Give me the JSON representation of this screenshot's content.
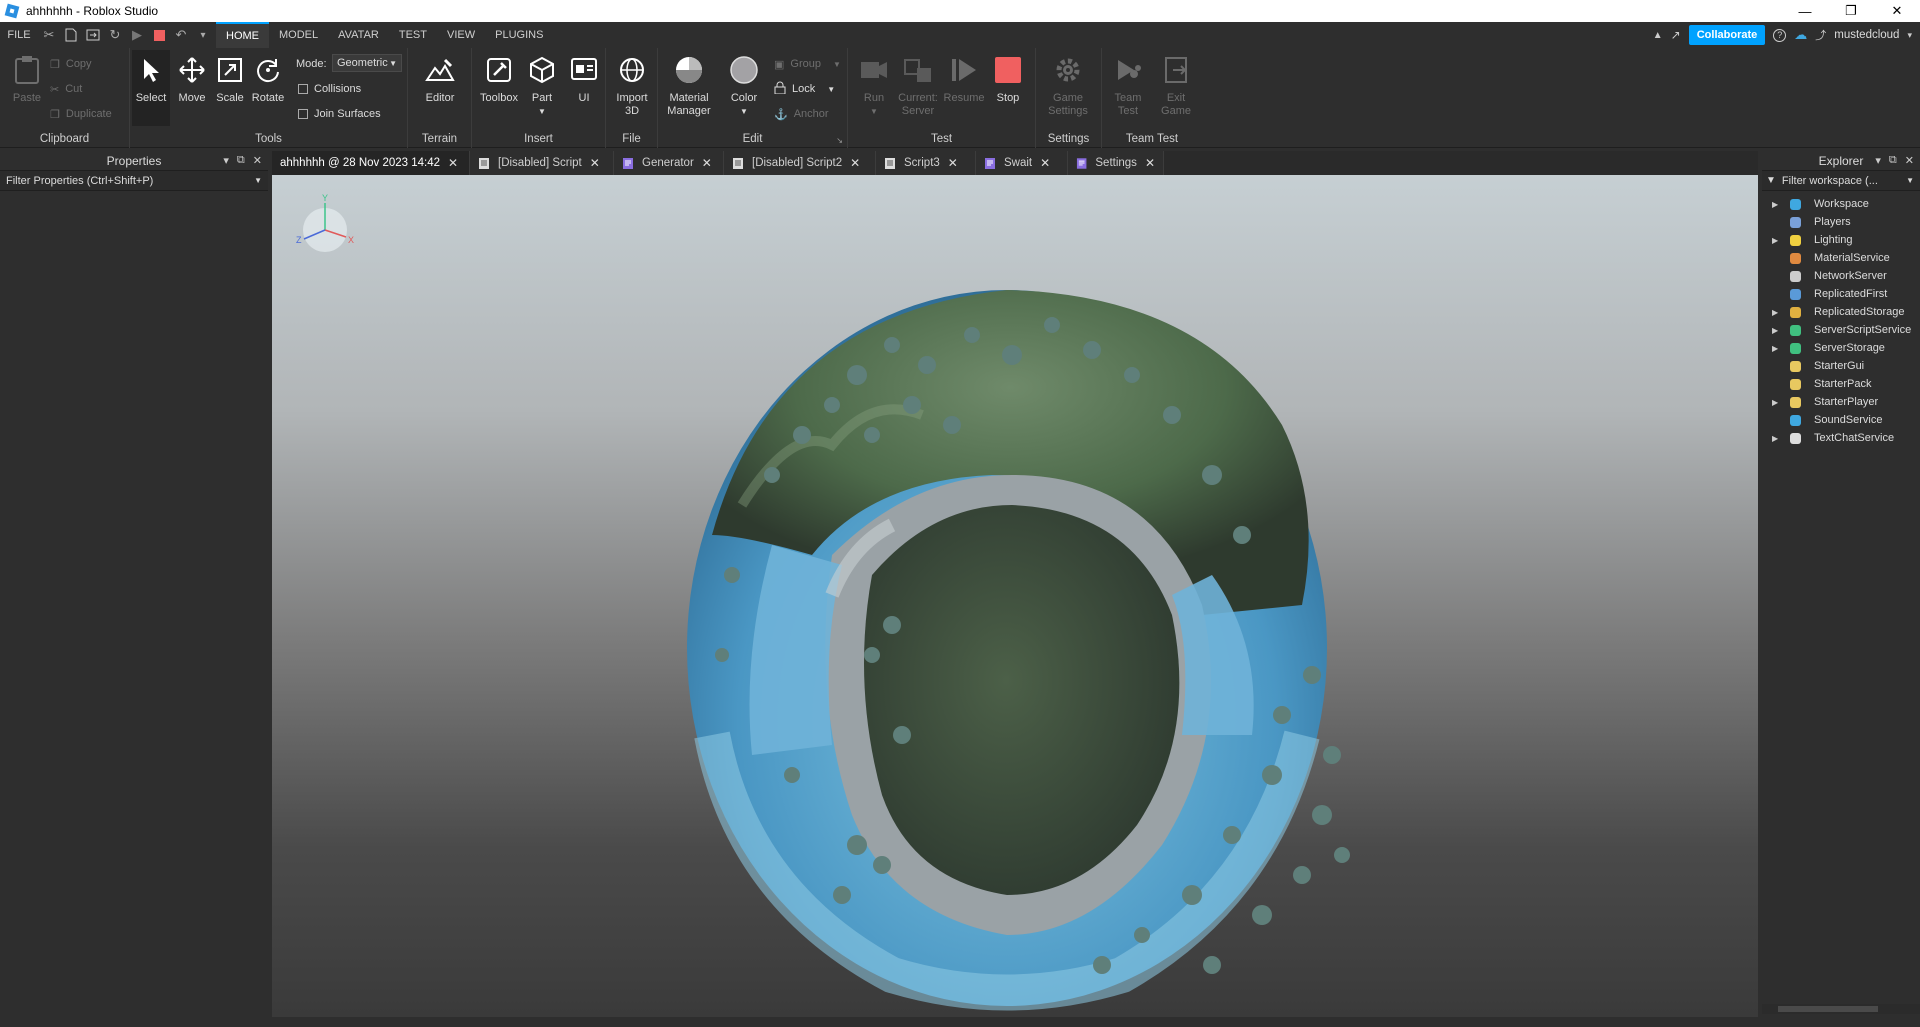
{
  "window": {
    "title": "ahhhhhh - Roblox Studio"
  },
  "menu": {
    "tabs": [
      "FILE",
      "HOME",
      "MODEL",
      "AVATAR",
      "TEST",
      "VIEW",
      "PLUGINS"
    ],
    "active": "HOME",
    "collaborate": "Collaborate",
    "user": "mustedcloud"
  },
  "ribbon": {
    "clipboard": {
      "label": "Clipboard",
      "paste": "Paste",
      "copy": "Copy",
      "cut": "Cut",
      "duplicate": "Duplicate"
    },
    "tools": {
      "label": "Tools",
      "select": "Select",
      "move": "Move",
      "scale": "Scale",
      "rotate": "Rotate",
      "mode_label": "Mode:",
      "mode_value": "Geometric",
      "collisions": "Collisions",
      "join_surfaces": "Join Surfaces"
    },
    "terrain": {
      "label": "Terrain",
      "editor": "Editor"
    },
    "insert": {
      "label": "Insert",
      "toolbox": "Toolbox",
      "part": "Part",
      "ui": "UI"
    },
    "file": {
      "label": "File",
      "import3d_1": "Import",
      "import3d_2": "3D"
    },
    "edit": {
      "label": "Edit",
      "material_1": "Material",
      "material_2": "Manager",
      "color": "Color",
      "group": "Group",
      "lock": "Lock",
      "anchor": "Anchor"
    },
    "test": {
      "label": "Test",
      "run": "Run",
      "current_1": "Current:",
      "current_2": "Server",
      "resume": "Resume",
      "stop": "Stop"
    },
    "settings": {
      "label": "Settings",
      "game_1": "Game",
      "game_2": "Settings"
    },
    "teamtest": {
      "label": "Team Test",
      "team_1": "Team",
      "team_2": "Test",
      "exit_1": "Exit",
      "exit_2": "Game"
    }
  },
  "properties": {
    "title": "Properties",
    "filter": "Filter Properties (Ctrl+Shift+P)"
  },
  "doc_tabs": [
    {
      "label": "ahhhhhh @ 28 Nov 2023 14:42",
      "icon": "none"
    },
    {
      "label": "[Disabled] Script",
      "icon": "script-icon"
    },
    {
      "label": "Generator",
      "icon": "modulescript-icon"
    },
    {
      "label": "[Disabled] Script2",
      "icon": "script-icon"
    },
    {
      "label": "Script3",
      "icon": "script-icon"
    },
    {
      "label": "Swait",
      "icon": "modulescript-icon"
    },
    {
      "label": "Settings",
      "icon": "modulescript-icon"
    }
  ],
  "explorer": {
    "title": "Explorer",
    "filter": "Filter workspace (...",
    "items": [
      {
        "label": "Workspace",
        "expandable": true,
        "icon": "workspace-icon",
        "color": "#3fa8e0"
      },
      {
        "label": "Players",
        "expandable": false,
        "icon": "players-icon",
        "color": "#7aa0d8"
      },
      {
        "label": "Lighting",
        "expandable": true,
        "icon": "lightbulb-icon",
        "color": "#f0d040"
      },
      {
        "label": "MaterialService",
        "expandable": false,
        "icon": "material-icon",
        "color": "#e08a40"
      },
      {
        "label": "NetworkServer",
        "expandable": false,
        "icon": "network-icon",
        "color": "#cccccc"
      },
      {
        "label": "ReplicatedFirst",
        "expandable": false,
        "icon": "replicated-first-icon",
        "color": "#5a9ad8"
      },
      {
        "label": "ReplicatedStorage",
        "expandable": true,
        "icon": "replicated-storage-icon",
        "color": "#e0b040"
      },
      {
        "label": "ServerScriptService",
        "expandable": true,
        "icon": "server-script-icon",
        "color": "#40c080"
      },
      {
        "label": "ServerStorage",
        "expandable": true,
        "icon": "server-storage-icon",
        "color": "#40c080"
      },
      {
        "label": "StarterGui",
        "expandable": false,
        "icon": "folder-icon",
        "color": "#e8c860"
      },
      {
        "label": "StarterPack",
        "expandable": false,
        "icon": "folder-icon",
        "color": "#e8c860"
      },
      {
        "label": "StarterPlayer",
        "expandable": true,
        "icon": "starter-player-icon",
        "color": "#e8c860"
      },
      {
        "label": "SoundService",
        "expandable": false,
        "icon": "sound-icon",
        "color": "#3fa8e0"
      },
      {
        "label": "TextChatService",
        "expandable": true,
        "icon": "chat-icon",
        "color": "#dddddd"
      }
    ]
  },
  "viewport": {
    "axis_x": "X",
    "axis_y": "Y",
    "axis_z": "Z"
  }
}
